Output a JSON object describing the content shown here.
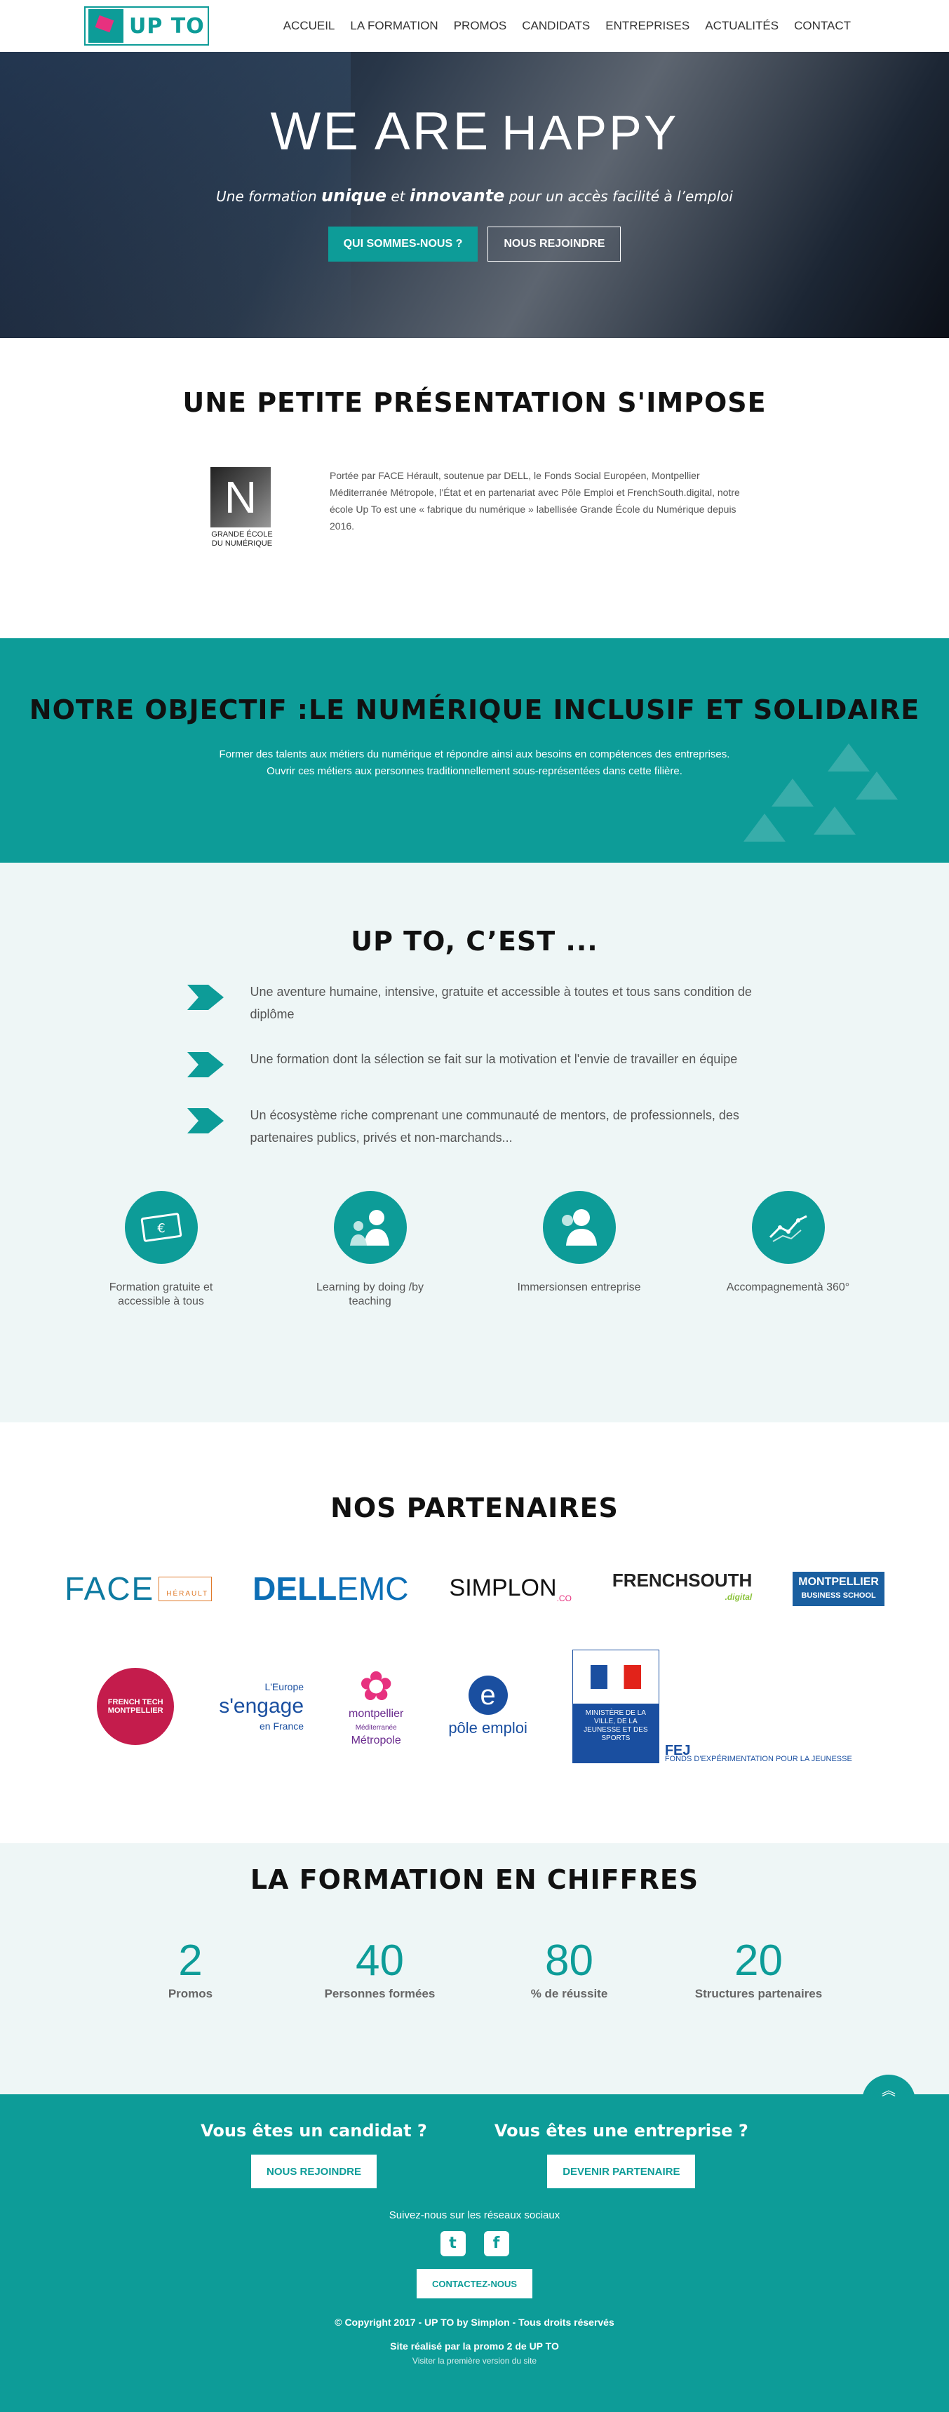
{
  "logo": {
    "text": "UP TO"
  },
  "nav": {
    "items": [
      {
        "label": "ACCUEIL"
      },
      {
        "label": "LA FORMATION"
      },
      {
        "label": "PROMOS"
      },
      {
        "label": "CANDIDATS"
      },
      {
        "label": "ENTREPRISES"
      },
      {
        "label": "ACTUALITÉS"
      },
      {
        "label": "CONTACT"
      }
    ]
  },
  "hero": {
    "title_part1": "WE ARE",
    "title_part2": "HAPPY",
    "sub_pre": "Une formation ",
    "sub_unique": "unique",
    "sub_mid": " et ",
    "sub_innov": "innovante",
    "sub_post": " pour un accès facilité à l’emploi",
    "btn_primary": "QUI SOMMES-NOUS ?",
    "btn_secondary": "NOUS REJOINDRE"
  },
  "presentation": {
    "title": "UNE PETITE PRÉSENTATION S'IMPOSE",
    "logo_letter": "N",
    "logo_caption": "GRANDE ÉCOLE DU NUMÉRIQUE",
    "text": "Portée par FACE Hérault, soutenue par DELL, le Fonds Social Européen, Montpellier Méditerranée Métropole, l'État et en partenariat avec Pôle Emploi et FrenchSouth.digital, notre école Up To est une « fabrique du numérique » labellisée Grande École du Numérique depuis 2016."
  },
  "objective": {
    "title": "NOTRE OBJECTIF :LE NUMÉRIQUE INCLUSIF ET SOLIDAIRE",
    "line1": "Former des talents aux métiers du numérique et répondre ainsi aux besoins en compétences des entreprises.",
    "line2": "Ouvrir ces métiers aux personnes traditionnellement sous-représentées dans cette filière."
  },
  "upto": {
    "title": "UP TO, C’EST ...",
    "points": [
      {
        "text": "Une aventure humaine, intensive, gratuite et accessible à toutes et tous sans condition de diplôme"
      },
      {
        "text": "Une formation dont la sélection se fait sur la motivation et l'envie de travailler en équipe"
      },
      {
        "text": "Un écosystème riche comprenant une communauté de mentors, de professionnels, des partenaires publics, privés et non-marchands..."
      }
    ],
    "features": [
      {
        "label": "Formation gratuite et accessible à tous",
        "icon": "money-icon"
      },
      {
        "label": "Learning by doing /by teaching",
        "icon": "people-icon"
      },
      {
        "label": "Immersionsen entreprise",
        "icon": "person-icon"
      },
      {
        "label": "Accompagnementà 360°",
        "icon": "chart-icon"
      }
    ]
  },
  "partners": {
    "title": "NOS PARTENAIRES",
    "face": "FACE",
    "face_sub": "HÉRAULT",
    "dell": "DELL",
    "dell_emc": "EMC",
    "simplon": "SIMPLON",
    "simplon_co": ".CO",
    "frenchsouth": "FRENCHSOUTH",
    "frenchsouth_digital": ".digital",
    "mbs_line1": "MONTPELLIER",
    "mbs_line2": "BUSINESS SCHOOL",
    "frenchtech": "FRENCH TECH MONTPELLIER",
    "europe_top": "L'Europe",
    "europe_mid": "s'engage",
    "europe_bot": "en France",
    "mtp_line1": "montpellier",
    "mtp_line2": "Méditerranée",
    "mtp_line3": "Métropole",
    "pole": "pôle emploi",
    "ministere": "MINISTÈRE DE LA VILLE, DE LA JEUNESSE ET DES SPORTS",
    "fej": "FEJ",
    "fej_sub": "FONDS D'EXPÉRIMENTATION POUR LA JEUNESSE"
  },
  "numbers": {
    "title": "LA FORMATION EN CHIFFRES",
    "items": [
      {
        "value": "2",
        "label": "Promos"
      },
      {
        "value": "40",
        "label": "Personnes formées"
      },
      {
        "value": "80",
        "label": "% de réussite"
      },
      {
        "value": "20",
        "label": "Structures partenaires"
      }
    ]
  },
  "footer": {
    "candidate_title": "Vous êtes un candidat ?",
    "candidate_btn": "NOUS REJOINDRE",
    "company_title": "Vous êtes une entreprise ?",
    "company_btn": "DEVENIR PARTENAIRE",
    "follow": "Suivez-nous sur les réseaux sociaux",
    "contact_btn": "CONTACTEZ-NOUS",
    "copyright": "© Copyright 2017 - UP TO by Simplon - Tous droits réservés",
    "made_by": "Site réalisé par la promo 2 de UP TO",
    "first_version": "Visiter la première version du site"
  }
}
